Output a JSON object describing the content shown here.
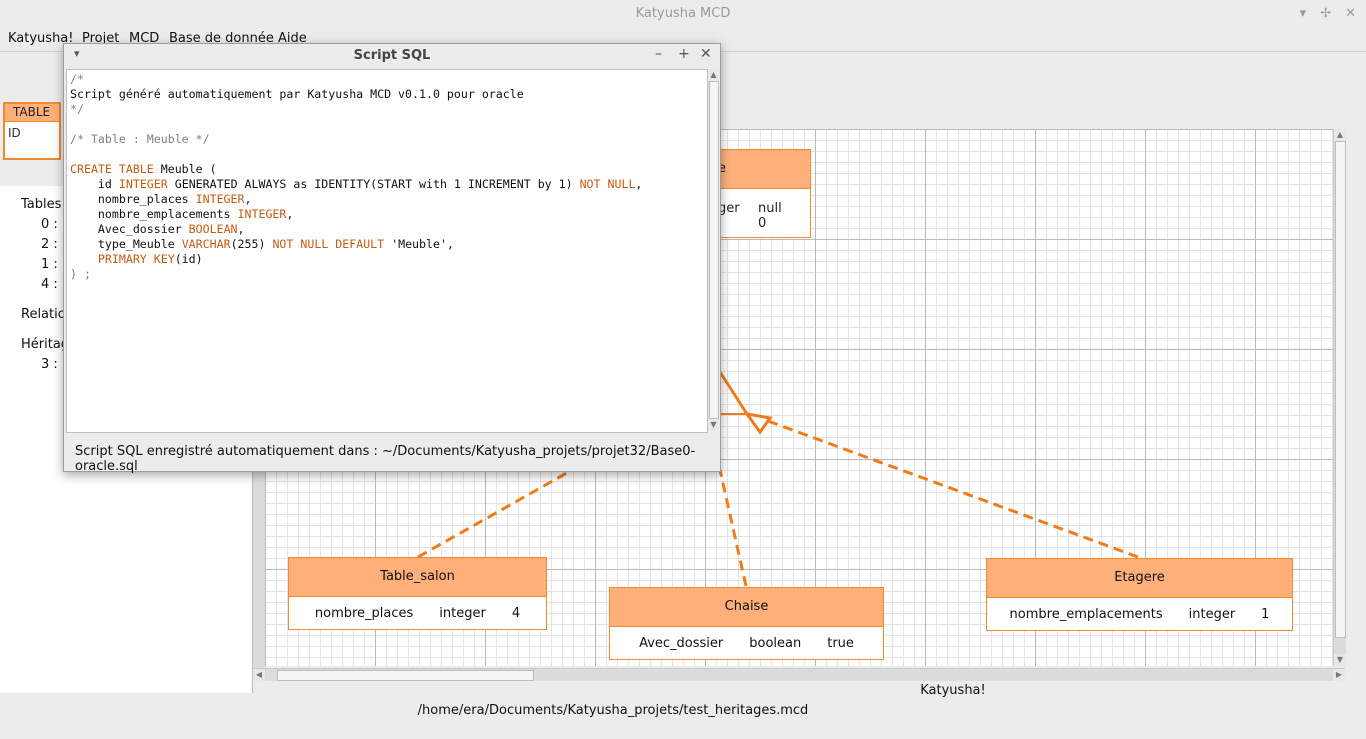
{
  "window": {
    "title": "Katyusha MCD",
    "controls": [
      "▾",
      "✢",
      "✕"
    ]
  },
  "menu": {
    "items": [
      "Katyusha!",
      "Projet",
      "MCD",
      "Base de donnée",
      "Aide"
    ]
  },
  "palette": {
    "table_tool": {
      "header": "TABLE",
      "field": "ID"
    }
  },
  "left_panel": {
    "tables_label": "Tables",
    "table_rows": [
      "0 : ",
      "2 : ",
      "1 : ",
      "4 : "
    ],
    "relations_label": "Relation",
    "heritages_label": "Héritag",
    "heritage_rows": [
      "3 : "
    ]
  },
  "diagram": {
    "entities": {
      "meuble": {
        "title_partial": "e",
        "attrs_partial": [
          "ger",
          "null",
          "0"
        ]
      },
      "table_salon": {
        "title": "Table_salon",
        "attr": {
          "name": "nombre_places",
          "type": "integer",
          "value": "4"
        }
      },
      "chaise": {
        "title": "Chaise",
        "attr": {
          "name": "Avec_dossier",
          "type": "boolean",
          "value": "true"
        }
      },
      "etagere": {
        "title": "Etagere",
        "attr": {
          "name": "nombre_emplacements",
          "type": "integer",
          "value": "1"
        }
      }
    },
    "link_color": "#f07b1a"
  },
  "status": {
    "line1": "Katyusha!",
    "line2": "/home/era/Documents/Katyusha_projets/test_heritages.mcd"
  },
  "dialog": {
    "title": "Script SQL",
    "buttons": {
      "menu": "▾",
      "minimize": "–",
      "maximize": "+",
      "close": "✕"
    },
    "sql": {
      "line_comment_open": "/*",
      "line_generated": "Script généré automatiquement par Katyusha MCD v0.1.0 pour oracle",
      "line_comment_close": "*/",
      "line_table_comment": "/* Table : Meuble */",
      "create_kw": "CREATE TABLE",
      "table_name": " Meuble (",
      "id_col": "    id ",
      "integer_kw": "INTEGER",
      "id_rest": " GENERATED ALWAYS as IDENTITY(START with 1 INCREMENT by 1) ",
      "not_null_kw": "NOT NULL",
      "comma": ",",
      "col_places": "    nombre_places ",
      "col_emplacements": "    nombre_emplacements ",
      "col_dossier": "    Avec_dossier ",
      "boolean_kw": "BOOLEAN",
      "col_type": "    type_Meuble ",
      "varchar_kw": "VARCHAR",
      "varchar_len": "(255) ",
      "not_null_default_kw": "NOT NULL DEFAULT",
      "default_val": " 'Meuble',",
      "pk_indent": "    ",
      "pk_kw": "PRIMARY KEY",
      "pk_rest": "(id)",
      "close_stmt": ") ;"
    },
    "status_text": "Script SQL enregistré automatiquement dans : ~/Documents/Katyusha_projets/projet32/Base0-oracle.sql"
  }
}
